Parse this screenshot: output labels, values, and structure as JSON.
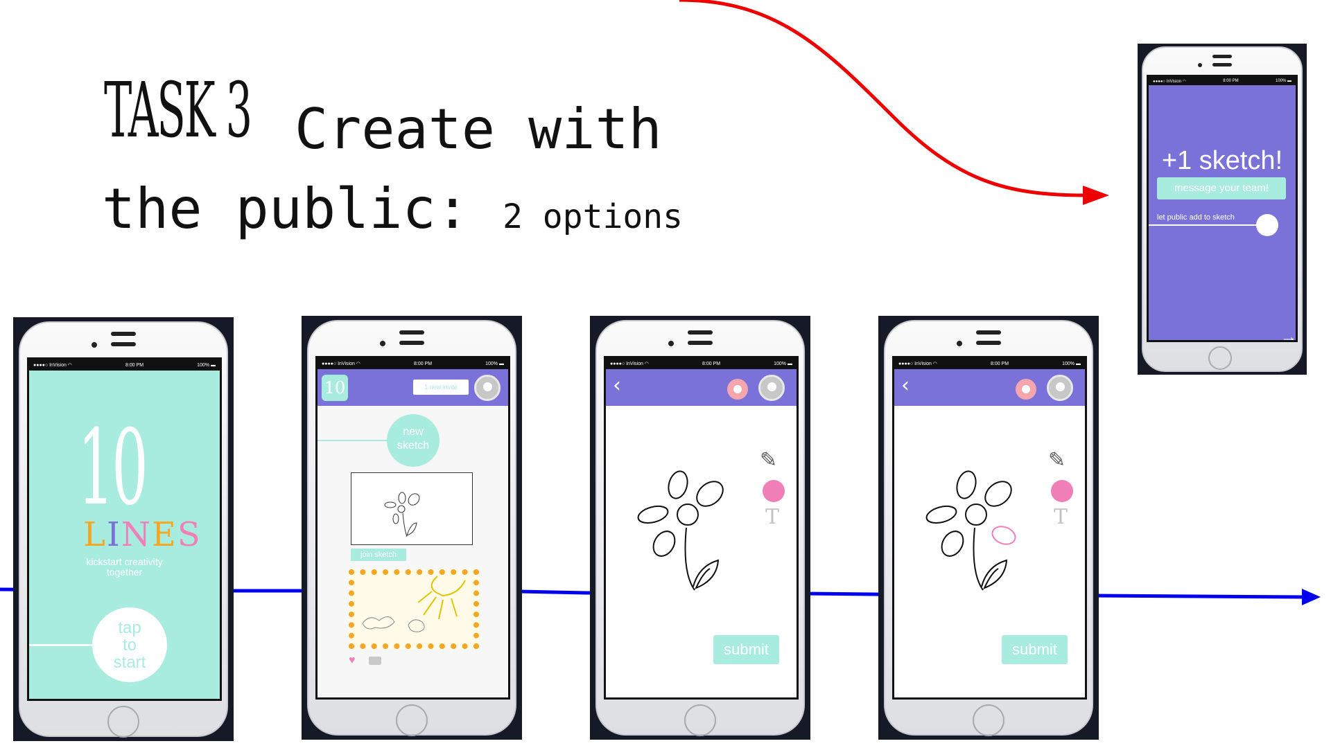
{
  "slide": {
    "task_label": "TASK 3",
    "title_line1": "Create with",
    "title_line2": "the public:",
    "title_suffix": "2 options"
  },
  "status_bar": {
    "carrier": "●●●●○ InVision ◠",
    "time": "8:00 PM",
    "battery": "100% ▬"
  },
  "screens": {
    "splash": {
      "logo_number": "10",
      "logo_word": [
        "L",
        "I",
        "N",
        "E",
        "S"
      ],
      "logo_colors": [
        "#f5a623",
        "#7a72d8",
        "#f07fb8",
        "#f5a623",
        "#f07fb8"
      ],
      "tagline": "kickstart creativity together",
      "start_button": [
        "tap",
        "to",
        "start"
      ]
    },
    "feed": {
      "badge": "10",
      "invite_label": "1 new invite",
      "new_sketch_label": [
        "new",
        "sketch"
      ],
      "join_label": "join sketch"
    },
    "editor": {
      "back_icon": "‹",
      "text_tool": "T",
      "submit_label": "submit"
    },
    "confirmation": {
      "title": "+1 sketch!",
      "message_button": "message your team!",
      "toggle_label": "let public add to sketch",
      "next_icon": "→"
    }
  },
  "colors": {
    "mint": "#a8ece0",
    "purple": "#7a72d8",
    "pink": "#f07fb8",
    "flow_arrow": "#0000ee",
    "curve_arrow": "#ee0000"
  }
}
